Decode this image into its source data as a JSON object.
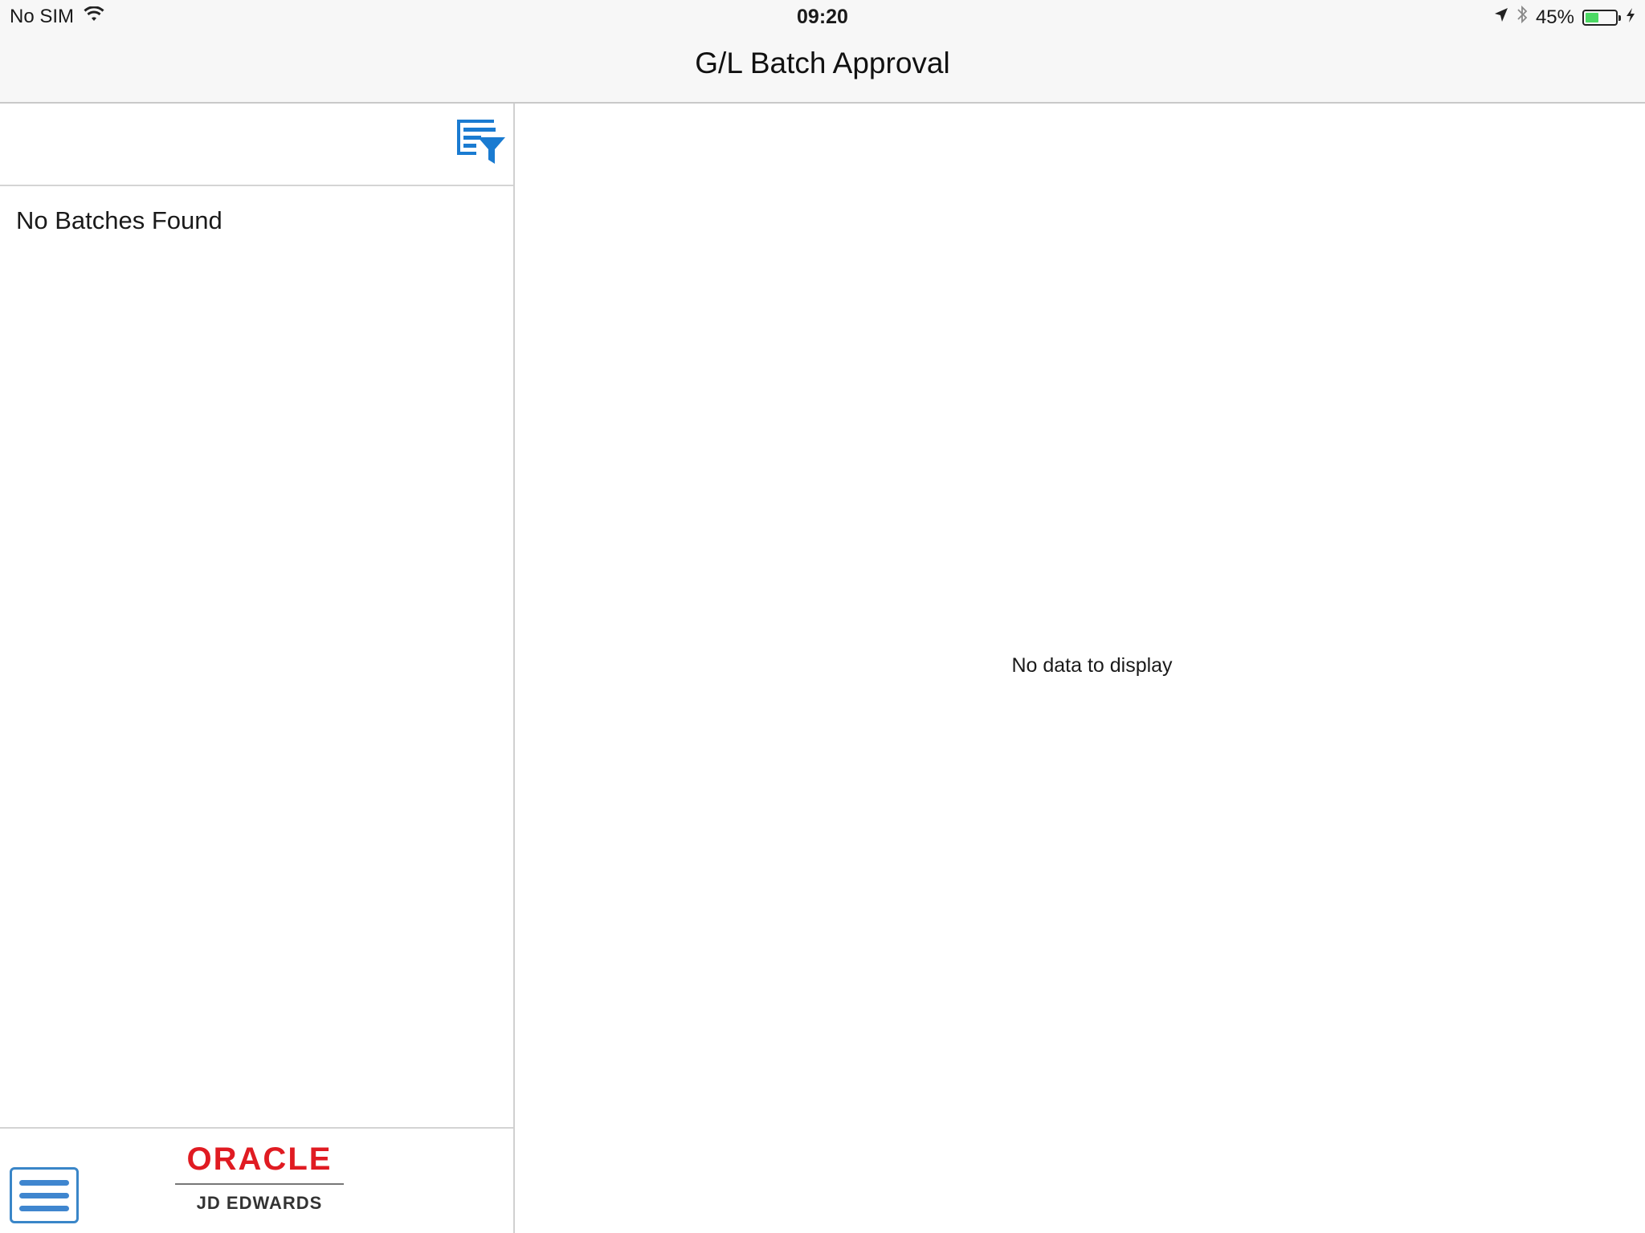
{
  "status_bar": {
    "carrier": "No SIM",
    "time": "09:20",
    "battery_percent": "45%",
    "battery_level": 0.45,
    "icons": [
      "wifi-icon",
      "location-arrow-icon",
      "bluetooth-icon",
      "battery-icon",
      "charging-bolt-icon"
    ]
  },
  "header": {
    "title": "G/L Batch Approval"
  },
  "list_pane": {
    "filter_icon": "filter-icon",
    "empty_message": "No Batches Found"
  },
  "footer": {
    "menu_icon": "hamburger-menu-icon",
    "logo_top": "ORACLE",
    "logo_bottom": "JD EDWARDS"
  },
  "detail_pane": {
    "empty_message": "No data to display"
  },
  "colors": {
    "accent": "#1a7bd1",
    "oracle_red": "#e01b22",
    "battery_green": "#4cd964"
  }
}
